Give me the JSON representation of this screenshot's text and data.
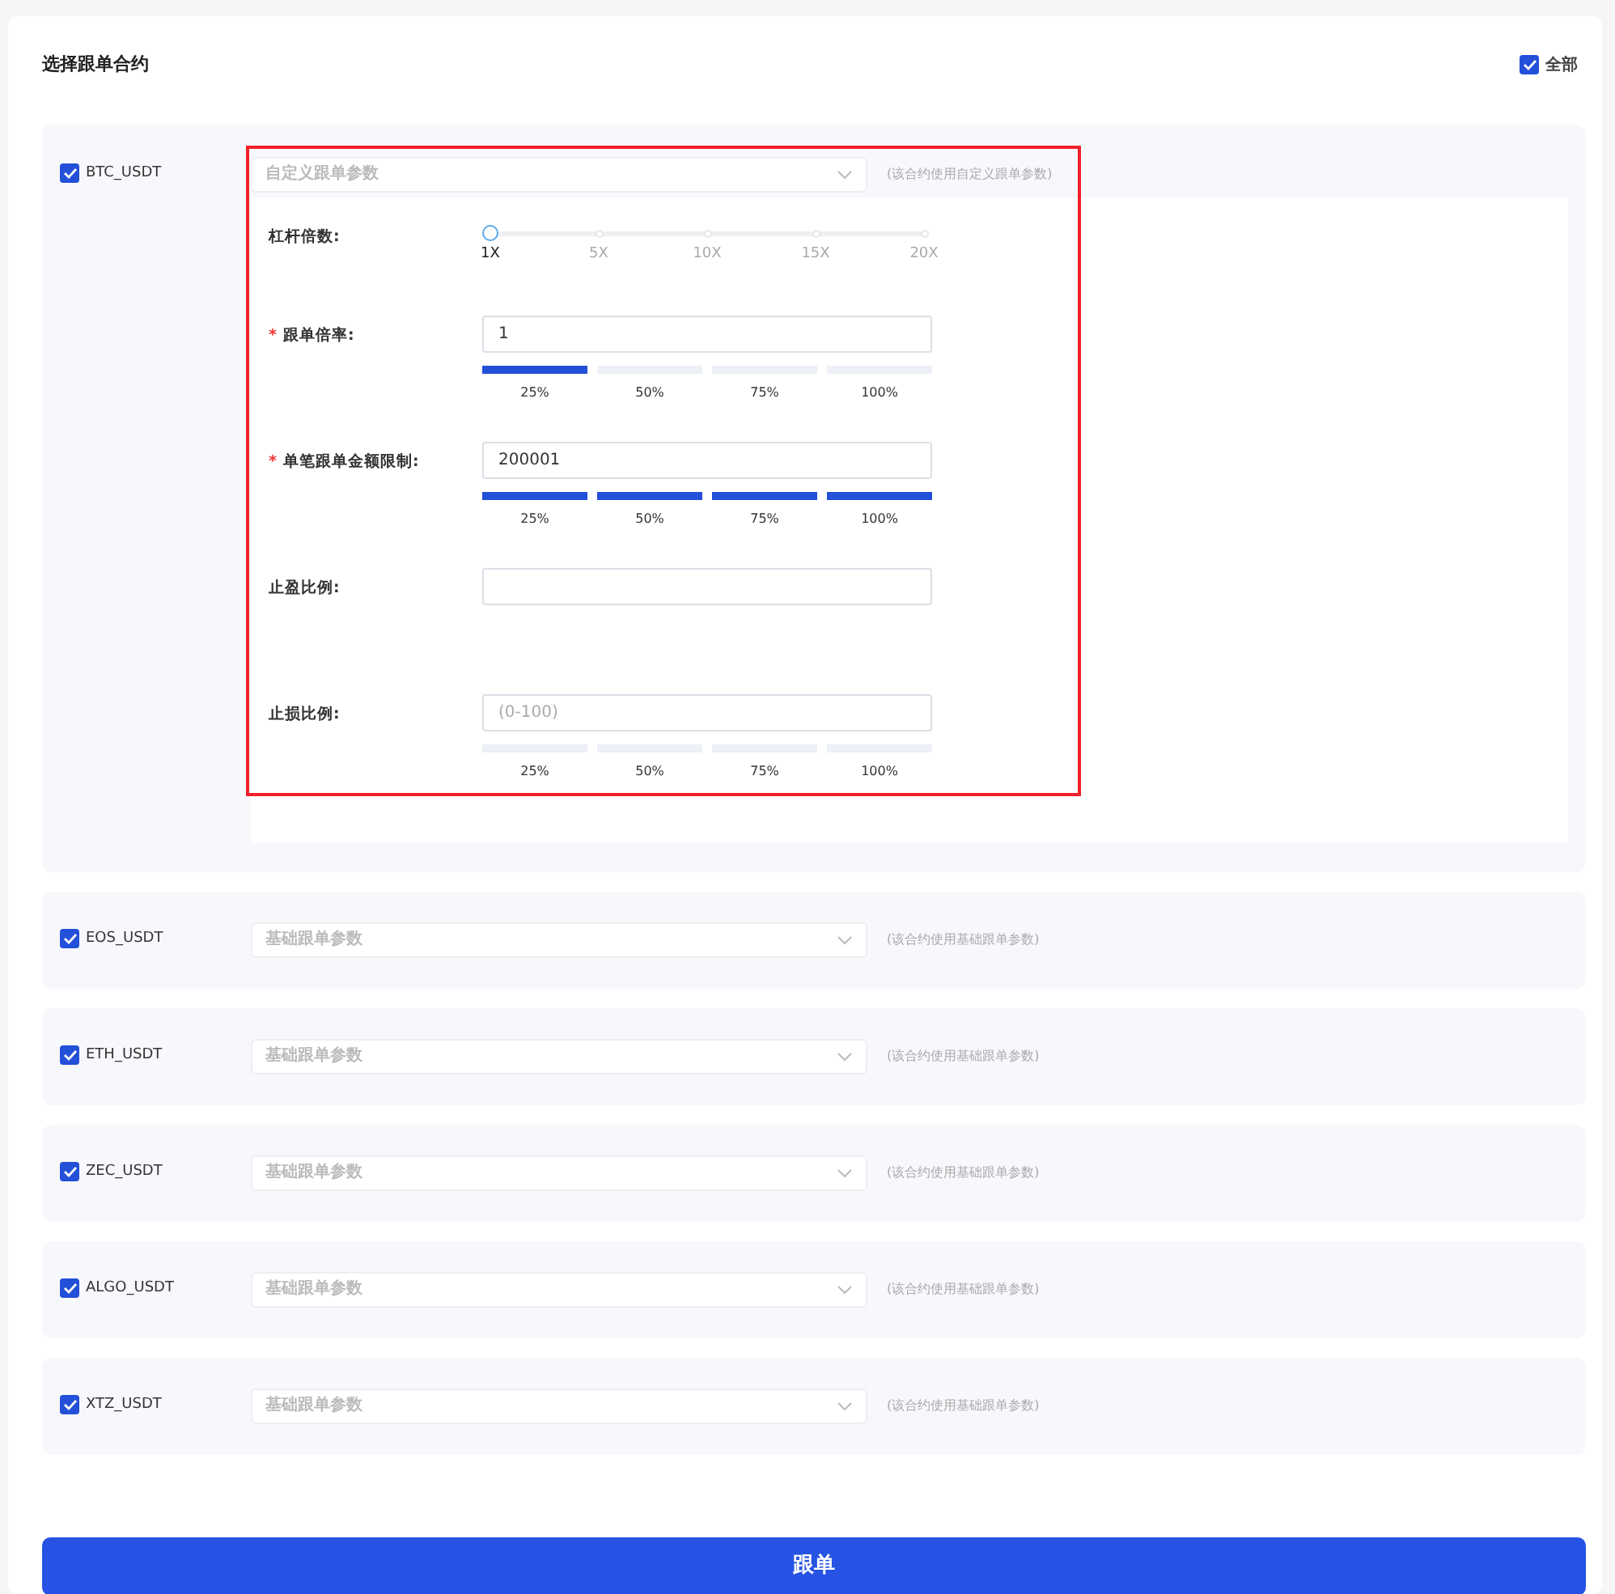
{
  "title": "选择跟单合约",
  "select_all": {
    "label": "全部",
    "checked": true
  },
  "contracts": [
    {
      "name": "BTC_USDT",
      "checked": true,
      "mode": "自定义跟单参数",
      "note": "(该合约使用自定义跟单参数)",
      "highlighted": true,
      "params": [
        {
          "kind": "slider",
          "label": "杠杆倍数:",
          "level": 0,
          "ticks": [
            {
              "label": "1X",
              "selected": true
            },
            {
              "label": "5X",
              "selected": false
            },
            {
              "label": "10X",
              "selected": false
            },
            {
              "label": "15X",
              "selected": false
            },
            {
              "label": "20X",
              "selected": false
            }
          ]
        },
        {
          "kind": "input",
          "label": "跟单倍率:",
          "required_mark": "*",
          "value": "1",
          "presets": [
            {
              "label": "25%",
              "selected": true
            },
            {
              "label": "50%",
              "selected": false
            },
            {
              "label": "75%",
              "selected": false
            },
            {
              "label": "100%",
              "selected": false
            }
          ]
        },
        {
          "kind": "input",
          "label": "单笔跟单金额限制:",
          "required_mark": "*",
          "value": "200001",
          "presets": [
            {
              "label": "25%",
              "selected": true
            },
            {
              "label": "50%",
              "selected": true
            },
            {
              "label": "75%",
              "selected": true
            },
            {
              "label": "100%",
              "selected": true
            }
          ]
        },
        {
          "kind": "input",
          "label": "止盈比例:"
        },
        {
          "kind": "input",
          "label": "止损比例:",
          "placeholder": "(0-100)",
          "presets": [
            {
              "label": "25%",
              "selected": false
            },
            {
              "label": "50%",
              "selected": false
            },
            {
              "label": "75%",
              "selected": false
            },
            {
              "label": "100%",
              "selected": false
            }
          ]
        }
      ]
    },
    {
      "name": "EOS_USDT",
      "checked": true,
      "mode": "基础跟单参数",
      "note": "(该合约使用基础跟单参数)",
      "highlighted": false
    },
    {
      "name": "ETH_USDT",
      "checked": true,
      "mode": "基础跟单参数",
      "note": "(该合约使用基础跟单参数)",
      "highlighted": false
    },
    {
      "name": "ZEC_USDT",
      "checked": true,
      "mode": "基础跟单参数",
      "note": "(该合约使用基础跟单参数)",
      "highlighted": false
    },
    {
      "name": "ALGO_USDT",
      "checked": true,
      "mode": "基础跟单参数",
      "note": "(该合约使用基础跟单参数)",
      "highlighted": false
    },
    {
      "name": "XTZ_USDT",
      "checked": true,
      "mode": "基础跟单参数",
      "note": "(该合约使用基础跟单参数)",
      "highlighted": false
    }
  ],
  "submit_button": "跟单"
}
